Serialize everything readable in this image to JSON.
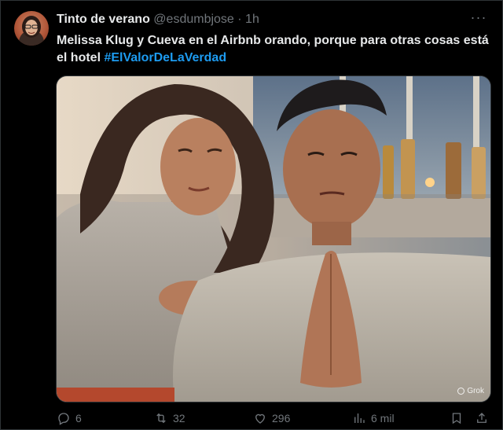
{
  "tweet": {
    "author": {
      "display_name": "Tinto de verano",
      "handle": "@esdumbjose",
      "separator": "·",
      "time": "1h"
    },
    "text": "Melissa Klug y Cueva en el Airbnb orando, porque para otras cosas está el hotel ",
    "hashtag": "#ElValorDeLaVerdad",
    "media": {
      "watermark": "Grok"
    },
    "more_label": "···"
  },
  "actions": {
    "replies": "6",
    "retweets": "32",
    "likes": "296",
    "views": "6 mil"
  },
  "colors": {
    "background": "#000000",
    "text": "#e7e9ea",
    "muted": "#71767b",
    "link": "#1d9bf0",
    "border": "#2f3336"
  },
  "icons": {
    "reply": "reply-icon",
    "retweet": "retweet-icon",
    "like": "heart-icon",
    "views": "views-chart-icon",
    "bookmark": "bookmark-icon",
    "share": "share-icon",
    "more": "more-dots-icon"
  }
}
